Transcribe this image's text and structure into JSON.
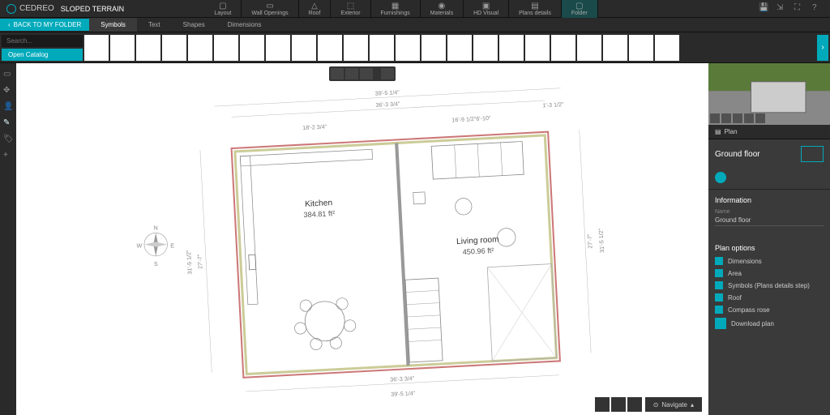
{
  "app": {
    "brand": "CEDREO",
    "title": "SLOPED TERRAIN"
  },
  "topTabs": [
    {
      "label": "Layout"
    },
    {
      "label": "Wall Openings"
    },
    {
      "label": "Roof"
    },
    {
      "label": "Exterior"
    },
    {
      "label": "Furnishings"
    },
    {
      "label": "Materials"
    },
    {
      "label": "HD Visual"
    },
    {
      "label": "Plans details"
    },
    {
      "label": "Folder"
    }
  ],
  "backButton": "BACK TO MY FOLDER",
  "subTabs": [
    {
      "label": "Symbols",
      "active": true
    },
    {
      "label": "Text"
    },
    {
      "label": "Shapes"
    },
    {
      "label": "Dimensions"
    }
  ],
  "search": {
    "placeholder": "Search..."
  },
  "openCatalog": "Open Catalog",
  "rooms": {
    "kitchen": {
      "name": "Kitchen",
      "area": "384.81 ft²"
    },
    "living": {
      "name": "Living room",
      "area": "450.96 ft²"
    }
  },
  "dimensions": {
    "top_outer": "39'-5 1/4\"",
    "top": "36'-3 3/4\"",
    "top_left": "18'-2 3/4\"",
    "top_right": "16'-9 1/2\"6'-10\"",
    "top_far_right": "1'-3 1/2\"",
    "right": "27'-7\"",
    "right_outer": "31'-5 1/2\"",
    "left": "27'-7\"",
    "left_outer": "31'-5 1/2\"",
    "bottom": "36'-3 3/4\"",
    "bottom_outer": "39'-5 1/4\""
  },
  "compass": {
    "n": "N",
    "s": "S",
    "e": "E",
    "w": "W"
  },
  "footer": {
    "navigate": "Navigate"
  },
  "panel": {
    "tab": "Plan",
    "title": "Ground floor",
    "info": {
      "title": "Information",
      "nameLabel": "Name",
      "nameValue": "Ground floor"
    },
    "options": {
      "title": "Plan options",
      "items": [
        "Dimensions",
        "Area",
        "Symbols (Plans details step)",
        "Roof",
        "Compass rose"
      ]
    },
    "download": "Download plan"
  }
}
